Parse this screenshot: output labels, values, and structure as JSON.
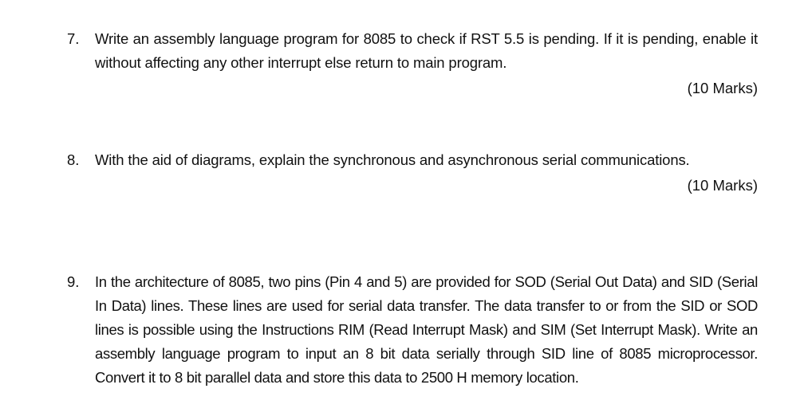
{
  "questions": [
    {
      "number": "7.",
      "text": "Write an assembly language program for 8085 to check if RST 5.5 is pending. If it is pending, enable it without affecting any other interrupt else return to main program.",
      "marks": "(10 Marks)"
    },
    {
      "number": "8.",
      "text": "With the aid of diagrams, explain the synchronous and asynchronous serial communications.",
      "marks": "(10 Marks)"
    },
    {
      "number": "9.",
      "text": "In the architecture of 8085, two pins (Pin 4 and 5) are provided for SOD (Serial Out Data) and SID (Serial In Data) lines. These lines are used for serial data transfer. The data transfer to or from the SID or SOD lines is possible using the Instructions RIM (Read Interrupt Mask) and SIM (Set Interrupt Mask). Write an assembly language program to input an 8 bit data serially through SID line of 8085 microprocessor. Convert it to 8 bit parallel data and store this data to 2500 H memory location."
    }
  ]
}
